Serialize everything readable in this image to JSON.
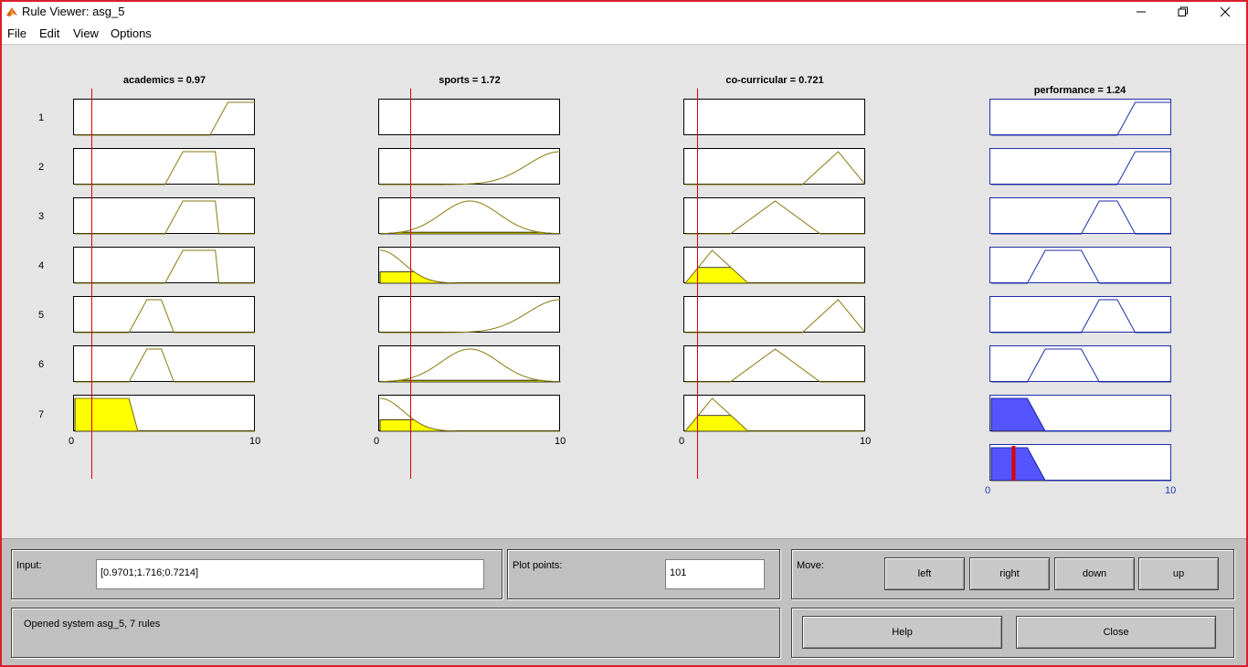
{
  "window": {
    "title": "Rule Viewer: asg_5",
    "controls": [
      "minimize",
      "restore",
      "close"
    ]
  },
  "menu": [
    "File",
    "Edit",
    "View",
    "Options"
  ],
  "inputs": [
    {
      "title": "academics = 0.97",
      "value": 0.97,
      "range": [
        0,
        10
      ],
      "min_label": "0",
      "max_label": "10"
    },
    {
      "title": "sports = 1.72",
      "value": 1.72,
      "range": [
        0,
        10
      ],
      "min_label": "0",
      "max_label": "10"
    },
    {
      "title": "co-curricular = 0.721",
      "value": 0.721,
      "range": [
        0,
        10
      ],
      "min_label": "0",
      "max_label": "10"
    }
  ],
  "output": {
    "title": "performance = 1.24",
    "value": 1.24,
    "range": [
      0,
      10
    ],
    "min_label": "0",
    "max_label": "10"
  },
  "rules": [
    "1",
    "2",
    "3",
    "4",
    "5",
    "6",
    "7"
  ],
  "membership": {
    "academics": [
      {
        "shape": "trap",
        "params": [
          7.5,
          8.5,
          10,
          10
        ],
        "fire": 0
      },
      {
        "shape": "trap",
        "params": [
          5,
          6,
          7.8,
          8
        ],
        "fire": 0
      },
      {
        "shape": "trap",
        "params": [
          5,
          6,
          7.8,
          8
        ],
        "fire": 0
      },
      {
        "shape": "trap",
        "params": [
          5,
          6,
          7.8,
          8
        ],
        "fire": 0
      },
      {
        "shape": "trap",
        "params": [
          3,
          4,
          4.8,
          5.5
        ],
        "fire": 0
      },
      {
        "shape": "trap",
        "params": [
          3,
          4,
          4.8,
          5.5
        ],
        "fire": 0
      },
      {
        "shape": "trap",
        "params": [
          0,
          0,
          3,
          3.5
        ],
        "fire": 1
      }
    ],
    "sports": [
      {
        "shape": "none",
        "params": [],
        "fire": 0
      },
      {
        "shape": "gauss",
        "params": [
          10,
          1.8
        ],
        "fire": 0
      },
      {
        "shape": "gauss",
        "params": [
          5,
          1.6
        ],
        "fire": 0.05
      },
      {
        "shape": "gauss",
        "params": [
          0,
          1.3
        ],
        "fire": 0.35
      },
      {
        "shape": "gauss",
        "params": [
          10,
          1.8
        ],
        "fire": 0
      },
      {
        "shape": "gauss",
        "params": [
          5,
          1.6
        ],
        "fire": 0.05
      },
      {
        "shape": "gauss",
        "params": [
          0,
          1.3
        ],
        "fire": 0.35
      }
    ],
    "co_curricular": [
      {
        "shape": "none",
        "params": [],
        "fire": 0
      },
      {
        "shape": "tri",
        "params": [
          6.5,
          8.5,
          10
        ],
        "fire": 0
      },
      {
        "shape": "tri",
        "params": [
          2.5,
          5,
          7.5
        ],
        "fire": 0
      },
      {
        "shape": "tri",
        "params": [
          0,
          1.5,
          3.5
        ],
        "fire": 0.48
      },
      {
        "shape": "tri",
        "params": [
          6.5,
          8.5,
          10
        ],
        "fire": 0
      },
      {
        "shape": "tri",
        "params": [
          2.5,
          5,
          7.5
        ],
        "fire": 0
      },
      {
        "shape": "tri",
        "params": [
          0,
          1.5,
          3.5
        ],
        "fire": 0.48
      }
    ],
    "performance": [
      {
        "shape": "trap",
        "params": [
          7,
          8,
          10,
          10
        ],
        "fire": 0
      },
      {
        "shape": "trap",
        "params": [
          7,
          8,
          10,
          10
        ],
        "fire": 0
      },
      {
        "shape": "trap",
        "params": [
          5,
          6,
          7,
          8
        ],
        "fire": 0
      },
      {
        "shape": "trap",
        "params": [
          2,
          3,
          5,
          6
        ],
        "fire": 0
      },
      {
        "shape": "trap",
        "params": [
          5,
          6,
          7,
          8
        ],
        "fire": 0
      },
      {
        "shape": "trap",
        "params": [
          2,
          3,
          5,
          6
        ],
        "fire": 0
      },
      {
        "shape": "trap",
        "params": [
          0,
          0,
          2,
          3
        ],
        "fire": 1
      }
    ],
    "aggregate": {
      "shape": "trap",
      "params": [
        0,
        0,
        2,
        3
      ],
      "fire": 1
    }
  },
  "colors": {
    "input_mf": "#8a7a10",
    "input_fill": "#ffff00",
    "output_mf": "#1f2ea8",
    "output_fill": "#5555ff",
    "indicator": "#e00000"
  },
  "panel": {
    "input_label": "Input:",
    "input_value": "[0.9701;1.716;0.7214]",
    "plot_points_label": "Plot points:",
    "plot_points_value": "101",
    "move_label": "Move:",
    "move_buttons": {
      "left": "left",
      "right": "right",
      "down": "down",
      "up": "up"
    },
    "status": "Opened system asg_5, 7 rules",
    "help": "Help",
    "close": "Close"
  }
}
